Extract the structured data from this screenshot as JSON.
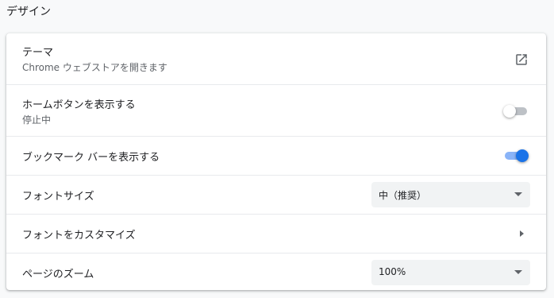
{
  "section": {
    "title": "デザイン"
  },
  "rows": {
    "theme": {
      "label": "テーマ",
      "sublabel": "Chrome ウェブストアを開きます",
      "icon": "open-in-new-icon"
    },
    "home_button": {
      "label": "ホームボタンを表示する",
      "sublabel": "停止中",
      "toggle_state": "off"
    },
    "bookmarks_bar": {
      "label": "ブックマーク バーを表示する",
      "toggle_state": "on"
    },
    "font_size": {
      "label": "フォントサイズ",
      "selected": "中（推奨）"
    },
    "customize_fonts": {
      "label": "フォントをカスタマイズ",
      "icon": "chevron-right-icon"
    },
    "page_zoom": {
      "label": "ページのズーム",
      "selected": "100%"
    }
  },
  "colors": {
    "accent": "#1a73e8",
    "accent_track": "#8ab4f8",
    "off_track": "#bdc1c6",
    "select_bg": "#f1f3f4"
  }
}
